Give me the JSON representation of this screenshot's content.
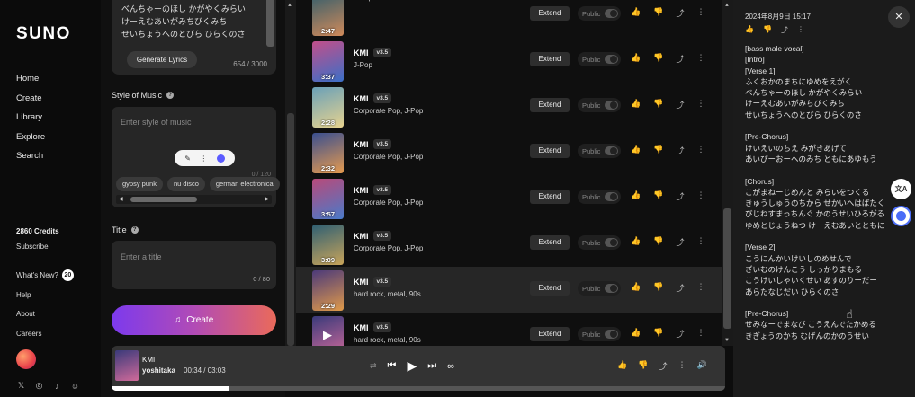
{
  "sidebar": {
    "logo": "SUNO",
    "nav": [
      "Home",
      "Create",
      "Library",
      "Explore",
      "Search"
    ],
    "credits": "2860 Credits",
    "subscribe": "Subscribe",
    "whats_new": "What's New?",
    "whats_new_count": "20",
    "help": "Help",
    "about": "About",
    "careers": "Careers",
    "social_icons": [
      "x-icon",
      "instagram-icon",
      "tiktok-icon",
      "discord-icon"
    ]
  },
  "form": {
    "lyrics_text": "べんちゃーのほし かがやくみらい\nけーえむあいがみちびくみち\nせいちょうへのとびら ひらくのさ",
    "generate_lyrics": "Generate Lyrics",
    "lyrics_count": "654 / 3000",
    "style_label": "Style of Music",
    "style_placeholder": "Enter style of music",
    "style_count": "0 / 120",
    "tags": [
      "gypsy punk",
      "nu disco",
      "german electronica"
    ],
    "title_label": "Title",
    "title_placeholder": "Enter a title",
    "title_count": "0 / 80",
    "create": "Create"
  },
  "songs": [
    {
      "title": "",
      "version": "",
      "genre": "J-Pop",
      "duration": "2:47",
      "colors": [
        "#3a5f6b",
        "#d08a5a"
      ]
    },
    {
      "title": "KMI",
      "version": "v3.5",
      "genre": "J-Pop",
      "duration": "3:37",
      "colors": [
        "#c24f8a",
        "#3b6fc7"
      ]
    },
    {
      "title": "KMI",
      "version": "v3.5",
      "genre": "Corporate Pop, J-Pop",
      "duration": "2:28",
      "colors": [
        "#6aa0b8",
        "#e7d38f"
      ]
    },
    {
      "title": "KMI",
      "version": "v3.5",
      "genre": "Corporate Pop, J-Pop",
      "duration": "2:32",
      "colors": [
        "#3a4f8f",
        "#e59a4f"
      ]
    },
    {
      "title": "KMI",
      "version": "v3.5",
      "genre": "Corporate Pop, J-Pop",
      "duration": "3:57",
      "colors": [
        "#b84a7a",
        "#4a7ac9"
      ]
    },
    {
      "title": "KMI",
      "version": "v3.5",
      "genre": "Corporate Pop, J-Pop",
      "duration": "3:09",
      "colors": [
        "#2f5f73",
        "#c8a45a"
      ]
    },
    {
      "title": "KMI",
      "version": "v3.5",
      "genre": "hard rock, metal, 90s",
      "duration": "2:29",
      "colors": [
        "#4c3a7a",
        "#e09a4a"
      ]
    },
    {
      "title": "KMI",
      "version": "v3.5",
      "genre": "hard rock, metal, 90s",
      "duration": "3:03",
      "colors": [
        "#3a3a7a",
        "#d06a9a"
      ]
    }
  ],
  "row_labels": {
    "extend": "Extend",
    "public": "Public"
  },
  "player": {
    "title": "KMI",
    "artist": "yoshitaka",
    "time": "00:34 / 03:03",
    "progress_fraction": 0.19
  },
  "right_panel": {
    "date": "2024年8月9日 15:17",
    "lyrics": "[bass male vocal]\n[Intro]\n[Verse 1]\nふくおかのまちにゆめをえがく\nべんちゃーのほし かがやくみらい\nけーえむあいがみちびくみち\nせいちょうへのとびら ひらくのさ\n\n[Pre-Chorus]\nけいえいのちえ みがきあげて\nあいぴーおーへのみち ともにあゆもう\n\n[Chorus]\nこがまねーじめんと みらいをつくる\nきゅうしゅうのちから せかいへはばたく\nびじねすまっちんぐ かのうせいひろがる\nゆめとじょうねつ けーえむあいとともに\n\n[Verse 2]\nこうにんかいけいしのめせんで\nざいむのけんこう しっかりまもる\nこうけいしゃいくせい あすのりーだー\nあらたなじだい ひらくのさ\n\n[Pre-Chorus]\nせみなーでまなび こうえんでたかめる\nきぎょうのかち むげんのかのうせい"
  }
}
